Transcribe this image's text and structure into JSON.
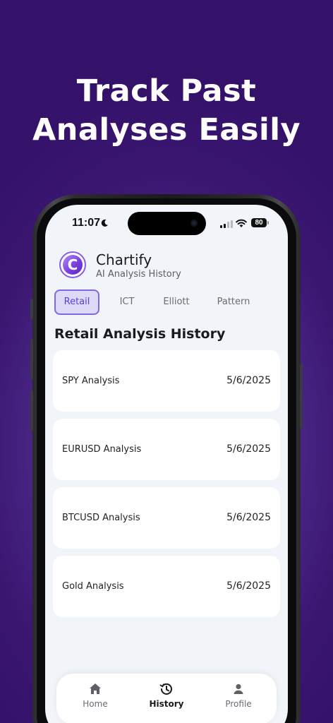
{
  "headline": {
    "line1": "Track Past",
    "line2": "Analyses Easily"
  },
  "status_bar": {
    "time": "11:07",
    "battery": "80"
  },
  "app": {
    "name": "Chartify",
    "subtitle": "AI Analysis History",
    "logo_letter": "C"
  },
  "tabs": [
    {
      "label": "Retail",
      "active": true
    },
    {
      "label": "ICT",
      "active": false
    },
    {
      "label": "Elliott",
      "active": false
    },
    {
      "label": "Pattern",
      "active": false
    }
  ],
  "section_title": "Retail Analysis History",
  "history": [
    {
      "title": "SPY Analysis",
      "date": "5/6/2025"
    },
    {
      "title": "EURUSD Analysis",
      "date": "5/6/2025"
    },
    {
      "title": "BTCUSD Analysis",
      "date": "5/6/2025"
    },
    {
      "title": "Gold Analysis",
      "date": "5/6/2025"
    }
  ],
  "bottom_nav": [
    {
      "label": "Home",
      "icon": "home-icon",
      "active": false
    },
    {
      "label": "History",
      "icon": "history-icon",
      "active": true
    },
    {
      "label": "Profile",
      "icon": "profile-icon",
      "active": false
    }
  ],
  "colors": {
    "background": "#3a1670",
    "accent": "#8267e4",
    "active_tab_bg": "#ddd9f6",
    "screen_bg": "#f1f4f9"
  }
}
